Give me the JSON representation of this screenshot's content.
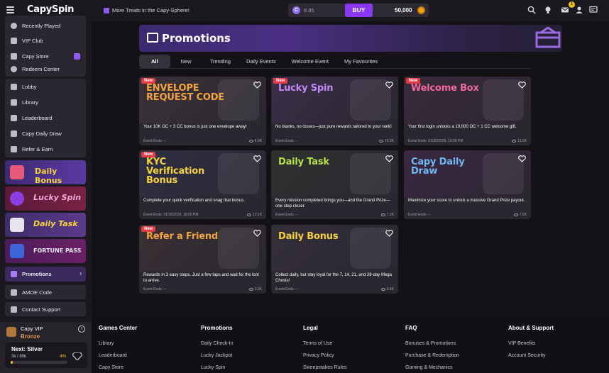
{
  "header": {
    "logo": "CapySpin",
    "treats_link": "More Treats in the Capy-Sphere!",
    "sc_balance": "8.85",
    "buy_label": "BUY",
    "gc_balance": "50,000",
    "notification_count": "1"
  },
  "sidebar": {
    "top_items": [
      {
        "label": "Recently Played",
        "icon": "clock-icon"
      },
      {
        "label": "VIP Club",
        "icon": "diamond-icon"
      },
      {
        "label": "Capy Store",
        "icon": "store-icon"
      },
      {
        "label": "Redeem Center",
        "icon": "redeem-icon"
      }
    ],
    "nav_items": [
      {
        "label": "Lobby",
        "icon": "home-icon"
      },
      {
        "label": "Library",
        "icon": "library-icon"
      },
      {
        "label": "Leaderboard",
        "icon": "leaderboard-icon"
      },
      {
        "label": "Capy Daily Draw",
        "icon": "draw-icon"
      },
      {
        "label": "Refer & Earn",
        "icon": "refer-icon"
      }
    ],
    "banners": [
      {
        "label": "Daily Bonus",
        "color": "#f5d23c"
      },
      {
        "label": "Lucky Spin",
        "color": "#f2a7d8"
      },
      {
        "label": "Daily Task",
        "color": "#f5d23c"
      },
      {
        "label": "FORTUNE PASS",
        "color": "#e7e4ef"
      }
    ],
    "promotions_label": "Promotions",
    "amoe_label": "AMOE Code",
    "contact_label": "Contact Support",
    "vip": {
      "title": "Capy VIP",
      "tier": "Bronze",
      "next_label": "Next: Silver",
      "progress_text": "3k / 85k",
      "progress_pct": "4%",
      "progress_value": 0.04
    }
  },
  "main": {
    "title": "Promotions",
    "tabs": [
      "All",
      "New",
      "Trending",
      "Daily Events",
      "Welcome Event",
      "My Favourites"
    ],
    "cards": [
      {
        "title": "ENVELOPE REQUEST CODE",
        "badge": "New",
        "desc": "Your 10K OC + 3 CC bonus is just one envelope away!",
        "ends": "Event Ends: --",
        "views": "6.0K",
        "title_color": "#f4a33c",
        "bg": "#3a3238"
      },
      {
        "title": "Lucky Spin",
        "badge": "New",
        "desc": "No blanks, no losses—just pure rewards tailored to your rank!",
        "ends": "Event Ends: --",
        "views": "15.9K",
        "title_color": "#c48bf7",
        "bg": "#3a2e48"
      },
      {
        "title": "Welcome Box",
        "badge": "New",
        "desc": "Your first login unlocks a 10,000 OC + 1 CC welcome gift.",
        "ends": "Event Ends: 01/30/2026, 19:00 PM",
        "views": "11.5K",
        "title_color": "#f06a9c",
        "bg": "#3a2a3c"
      },
      {
        "title": "KYC Verification Bonus",
        "badge": "New",
        "desc": "Complete your quick verification and snag that bonus.",
        "ends": "Event Ends: 01/30/2026, 19:00 PM",
        "views": "12.1K",
        "title_color": "#f5d23c",
        "bg": "#2f3045"
      },
      {
        "title": "Daily Task",
        "badge": "",
        "desc": "Every mission completed brings you—and the Grand Prize—one step closer.",
        "ends": "Event Ends: --",
        "views": "7.3K",
        "title_color": "#b6e04a",
        "bg": "#2f3230"
      },
      {
        "title": "Capy Daily Draw",
        "badge": "",
        "desc": "Maximize your score to unlock a massive Grand Prize payout.",
        "ends": "Event Ends: --",
        "views": "7.6K",
        "title_color": "#6fb9f5",
        "bg": "#3b2743"
      },
      {
        "title": "Refer a Friend",
        "badge": "New",
        "desc": "Rewards in 3 easy steps. Just a few taps and wait for the loot to arrive.",
        "ends": "Event Ends: --",
        "views": "2.2K",
        "title_color": "#f4a33c",
        "bg": "#3a3034"
      },
      {
        "title": "Daily Bonus",
        "badge": "",
        "desc": "Collect daily, but stay loyal for the 7, 14, 21, and 28-day Mega Chests!",
        "ends": "Event Ends: --",
        "views": "9.8K",
        "title_color": "#f5d23c",
        "bg": "#35303c"
      }
    ]
  },
  "footer": {
    "columns": [
      {
        "heading": "Games Center",
        "links": [
          "Library",
          "Leaderboard",
          "Capy Store"
        ]
      },
      {
        "heading": "Promotions",
        "links": [
          "Daily Check-In",
          "Lucky Jackpot",
          "Lucky Spin"
        ]
      },
      {
        "heading": "Legal",
        "links": [
          "Terms of Use",
          "Privacy Policy",
          "Sweepstakes Rules"
        ]
      },
      {
        "heading": "FAQ",
        "links": [
          "Bonuses & Promotions",
          "Purchase & Redemption",
          "Gaming & Mechanics"
        ]
      },
      {
        "heading": "About & Support",
        "links": [
          "VIP Benefits",
          "Account Security"
        ]
      }
    ]
  }
}
